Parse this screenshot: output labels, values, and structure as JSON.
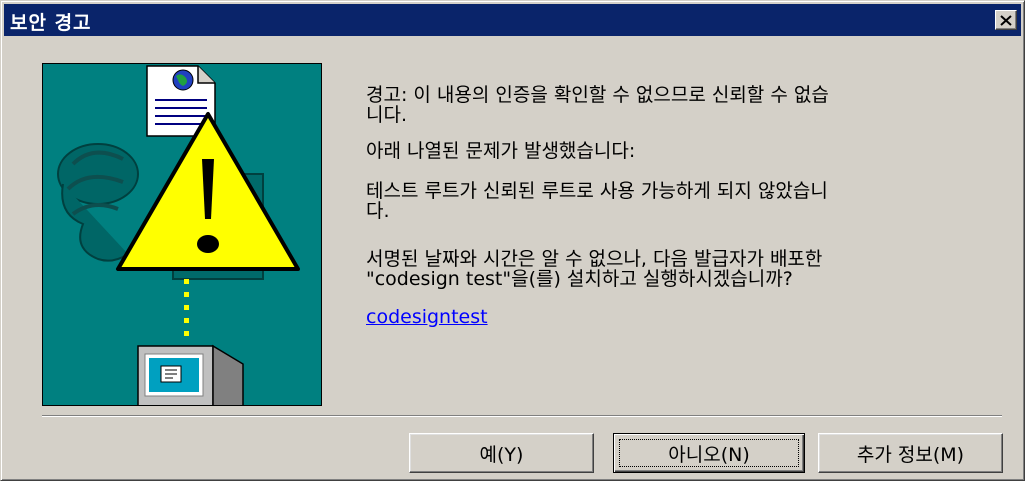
{
  "window": {
    "title": "보안 경고",
    "close_glyph": "×"
  },
  "message": {
    "warning": "경고: 이 내용의 인증을 확인할 수 없으므로 신뢰할 수 없습\n니다.",
    "problem_header": "아래 나열된 문제가 발생했습니다:",
    "root_problem": "테스트 루트가 신뢰된 루트로 사용 가능하게 되지 않았습니\n다.",
    "question": "서명된 날짜와 시간은 알 수 없으나, 다음 발급자가 배포한\n\"codesign test\"을(를) 설치하고 실행하시겠습니까?",
    "publisher_link": "codesigntest"
  },
  "buttons": {
    "yes_label": "예(Y)",
    "no_label": "아니오(N)",
    "more_info_label": "추가 정보(M)"
  },
  "icons": [
    "close-icon",
    "document-globe-icon",
    "warning-triangle-icon",
    "certificate-seal-icon",
    "computer-icon"
  ],
  "colors": {
    "titlebar": "#0a246a",
    "dialog_face": "#d4d0c8",
    "illustration_bg": "#008080",
    "warning_yellow": "#ffff00",
    "link": "#0000ff"
  }
}
